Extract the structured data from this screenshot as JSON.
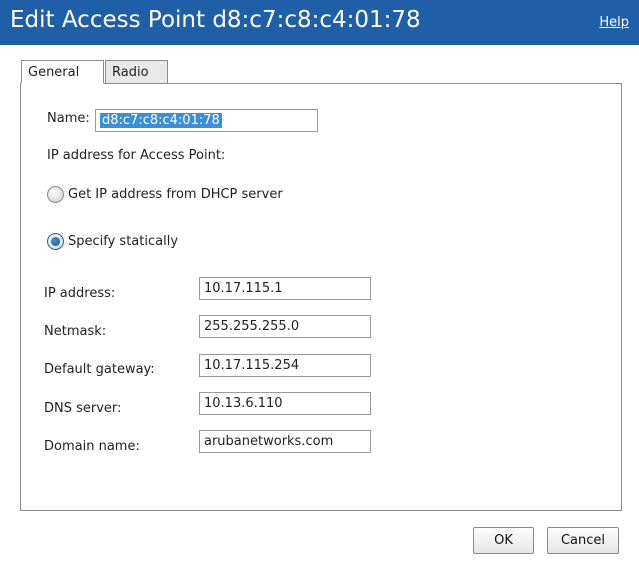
{
  "dialog": {
    "title": "Edit Access Point d8:c7:c8:c4:01:78",
    "help_label": "Help",
    "colors": {
      "titlebar": "#1f5fa8",
      "selection": "#3b8fd7"
    }
  },
  "tabs": [
    {
      "label": "General",
      "selected": true
    },
    {
      "label": "Radio",
      "selected": false
    }
  ],
  "general": {
    "name_label": "Name:",
    "name_value": "d8:c7:c8:c4:01:78",
    "ip_section_label": "IP address for Access Point:",
    "radio_dhcp_label": "Get IP address from DHCP server",
    "radio_dhcp_checked": false,
    "radio_static_label": "Specify statically",
    "radio_static_checked": true,
    "fields": [
      {
        "label": "IP address:",
        "value": "10.17.115.1"
      },
      {
        "label": "Netmask:",
        "value": "255.255.255.0"
      },
      {
        "label": "Default gateway:",
        "value": "10.17.115.254"
      },
      {
        "label": "DNS server:",
        "value": "10.13.6.110"
      },
      {
        "label": "Domain name:",
        "value": "arubanetworks.com"
      }
    ]
  },
  "buttons": {
    "ok_label": "OK",
    "cancel_label": "Cancel"
  }
}
